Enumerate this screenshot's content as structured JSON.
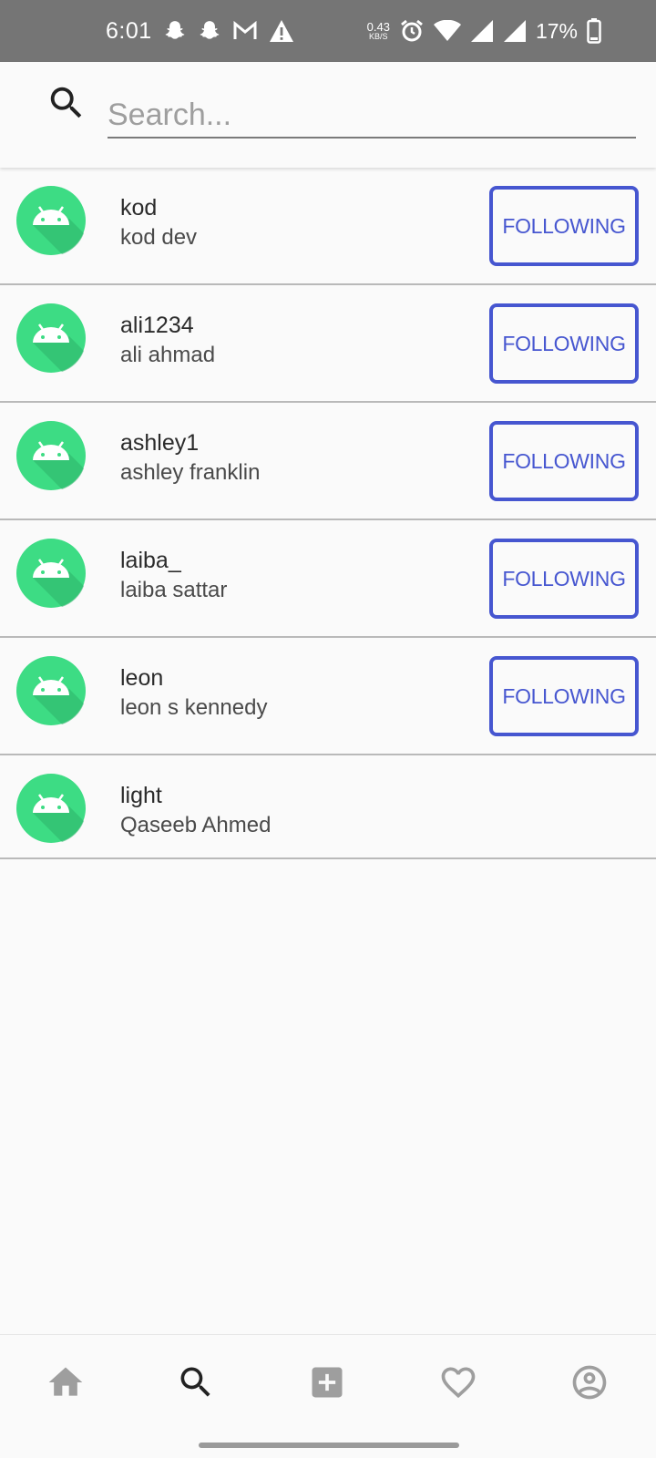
{
  "status_bar": {
    "time": "6:01",
    "net_speed_value": "0.43",
    "net_speed_unit": "KB/S",
    "battery": "17%",
    "left_icons": [
      "snapchat-icon",
      "snapchat-icon",
      "gmail-icon",
      "warning-icon"
    ],
    "right_icons": [
      "alarm-icon",
      "wifi-icon",
      "signal-icon",
      "signal-icon",
      "battery-icon"
    ]
  },
  "search": {
    "placeholder": "Search...",
    "value": ""
  },
  "users": [
    {
      "username": "kod",
      "fullname": "kod dev",
      "button": "FOLLOWING"
    },
    {
      "username": "ali1234",
      "fullname": "ali ahmad",
      "button": "FOLLOWING"
    },
    {
      "username": "ashley1",
      "fullname": "ashley franklin",
      "button": "FOLLOWING"
    },
    {
      "username": "laiba_",
      "fullname": "laiba sattar",
      "button": "FOLLOWING"
    },
    {
      "username": "leon",
      "fullname": "leon s kennedy",
      "button": "FOLLOWING"
    },
    {
      "username": "light",
      "fullname": "Qaseeb Ahmed"
    }
  ],
  "bottom_nav": {
    "items": [
      "home-icon",
      "search-icon",
      "add-box-icon",
      "heart-icon",
      "account-circle-icon"
    ],
    "active": "search-icon"
  },
  "colors": {
    "status_bar_bg": "#757575",
    "accent": "#4656d0",
    "avatar_green": "#3ddc84",
    "background": "#fafafa"
  }
}
